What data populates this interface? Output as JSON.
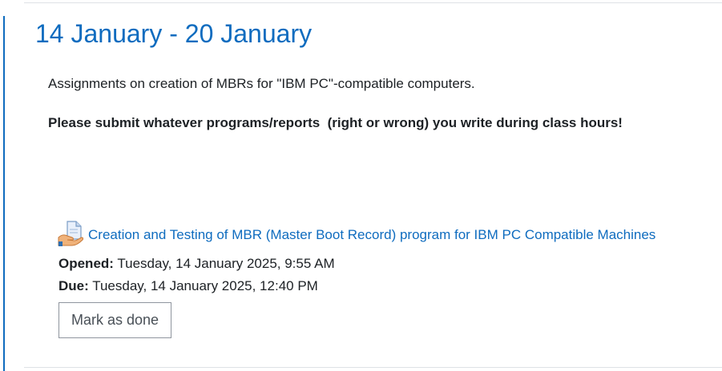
{
  "section": {
    "title": "14 January - 20 January",
    "summary": {
      "intro": "Assignments on creation of MBRs for \"IBM PC\"-compatible computers.",
      "notice": "Please submit whatever programs/reports  (right or wrong) you write during class hours!"
    }
  },
  "activity": {
    "icon": "assignment-icon",
    "link_text": "Creation and Testing of MBR (Master Boot Record) program for IBM PC Compatible Machines",
    "opened_label": "Opened:",
    "opened_value": "Tuesday, 14 January 2025, 9:55 AM",
    "due_label": "Due:",
    "due_value": "Tuesday, 14 January 2025, 12:40 PM",
    "completion_button": "Mark as done"
  },
  "colors": {
    "accent": "#0f6cbf",
    "text": "#1d2125",
    "border": "#8f959e"
  }
}
